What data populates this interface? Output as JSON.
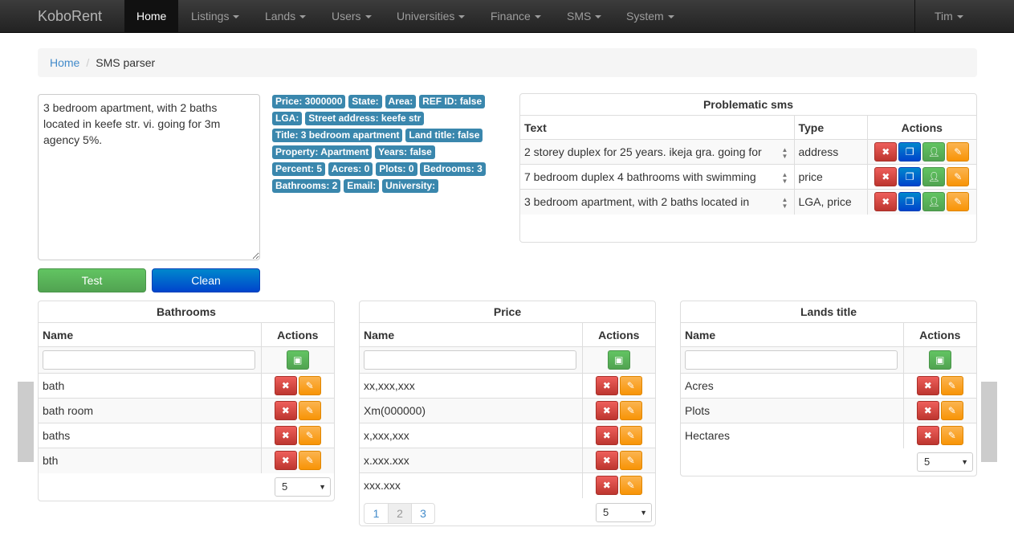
{
  "navbar": {
    "brand": "KoboRent",
    "items": [
      {
        "label": "Home",
        "active": true
      },
      {
        "label": "Listings"
      },
      {
        "label": "Lands"
      },
      {
        "label": "Users"
      },
      {
        "label": "Universities"
      },
      {
        "label": "Finance"
      },
      {
        "label": "SMS"
      },
      {
        "label": "System"
      }
    ],
    "user": "Tim"
  },
  "breadcrumb": {
    "home": "Home",
    "current": "SMS parser"
  },
  "parser": {
    "sms_text": "3 bedroom apartment, with 2 baths located in keefe str. vi. going for 3m agency 5%.",
    "test_label": "Test",
    "clean_label": "Clean",
    "results": [
      "Price: 3000000",
      "State:",
      "Area:",
      "REF ID: false",
      "LGA:",
      "Street address: keefe str",
      "Title: 3 bedroom apartment",
      "Land title: false",
      "Property: Apartment",
      "Years: false",
      "Percent: 5",
      "Acres: 0",
      "Plots: 0",
      "Bedrooms: 3",
      "Bathrooms: 2",
      "Email:",
      "University:"
    ]
  },
  "problematic": {
    "title": "Problematic sms",
    "headers": {
      "text": "Text",
      "type": "Type",
      "actions": "Actions"
    },
    "rows": [
      {
        "text": "2 storey duplex for 25 years. ikeja gra. going for",
        "type": "address"
      },
      {
        "text": "7 bedroom duplex 4 bathrooms with swimming",
        "type": "price"
      },
      {
        "text": "3 bedroom apartment, with 2 baths located in",
        "type": "LGA, price"
      }
    ]
  },
  "bathrooms": {
    "title": "Bathrooms",
    "headers": {
      "name": "Name",
      "actions": "Actions"
    },
    "rows": [
      "bath",
      "bath room",
      "baths",
      "bth"
    ],
    "page_size": "5"
  },
  "price": {
    "title": "Price",
    "headers": {
      "name": "Name",
      "actions": "Actions"
    },
    "rows": [
      "xx,xxx,xxx",
      "Xm(000000)",
      "x,xxx,xxx",
      "x.xxx.xxx",
      "xxx.xxx"
    ],
    "pages": [
      "1",
      "2",
      "3"
    ],
    "current_page": "2",
    "page_size": "5"
  },
  "lands_title": {
    "title": "Lands title",
    "headers": {
      "name": "Name",
      "actions": "Actions"
    },
    "rows": [
      "Acres",
      "Plots",
      "Hectares"
    ],
    "page_size": "5"
  },
  "icons": {
    "delete": "close-icon",
    "copy": "copy-icon",
    "user": "user-icon",
    "edit": "edit-icon",
    "save": "save-icon"
  },
  "colors": {
    "label": "#3a87ad",
    "danger": "#bd362f",
    "warning": "#f89406",
    "success": "#51a351",
    "primary": "#0044cc",
    "link": "#428bca"
  }
}
